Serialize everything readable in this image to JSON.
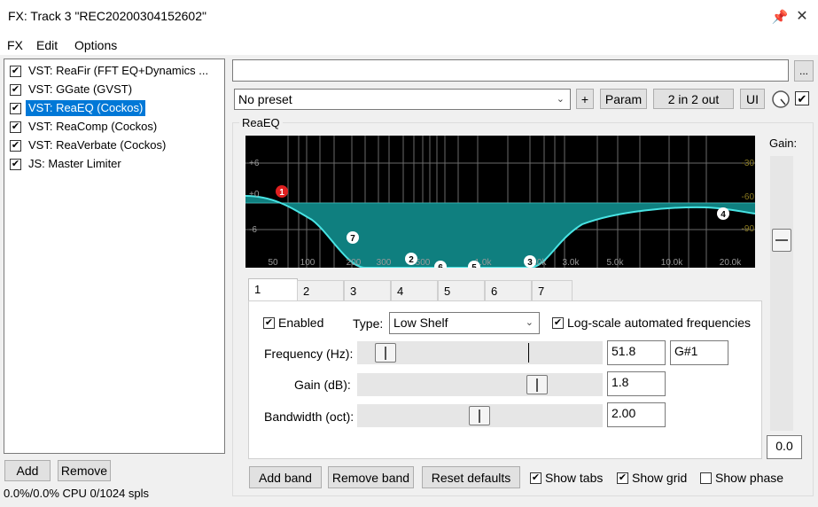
{
  "window": {
    "title": "FX: Track 3 \"REC20200304152602\""
  },
  "menu": [
    "FX",
    "Edit",
    "Options"
  ],
  "fx_chain": [
    {
      "label": "VST: ReaFir (FFT EQ+Dynamics ...",
      "checked": true,
      "selected": false
    },
    {
      "label": "VST: GGate (GVST)",
      "checked": true,
      "selected": false
    },
    {
      "label": "VST: ReaEQ (Cockos)",
      "checked": true,
      "selected": true
    },
    {
      "label": "VST: ReaComp (Cockos)",
      "checked": true,
      "selected": false
    },
    {
      "label": "VST: ReaVerbate (Cockos)",
      "checked": true,
      "selected": false
    },
    {
      "label": "JS: Master Limiter",
      "checked": true,
      "selected": false
    }
  ],
  "chain_buttons": {
    "add": "Add",
    "remove": "Remove"
  },
  "status": "0.0%/0.0% CPU 0/1024 spls",
  "toolbar": {
    "ellipsis": "...",
    "preset": "No preset",
    "plus": "+",
    "param": "Param",
    "io": "2 in 2 out",
    "ui": "UI",
    "enabled_checked": true
  },
  "plugin": {
    "name": "ReaEQ"
  },
  "graph": {
    "db_labels": [
      "+6",
      "+0",
      "-6"
    ],
    "right_labels": [
      "-30",
      "-60",
      "-90"
    ],
    "freq_labels": [
      "50",
      "100",
      "200",
      "300",
      "500",
      "1.0k",
      "2.0k",
      "3.0k",
      "5.0k",
      "10.0k",
      "20.0k"
    ],
    "band_points": [
      "1",
      "7",
      "2",
      "6",
      "5",
      "3",
      "4"
    ],
    "colors": {
      "fill": "#0f7f7f",
      "curve": "#48e4e4",
      "grid": "#6a6a6a",
      "active_point": "#e02020"
    }
  },
  "master_gain": {
    "label": "Gain:",
    "value": "0.0",
    "level_db": 0
  },
  "tabs": [
    "1",
    "2",
    "3",
    "4",
    "5",
    "6",
    "7"
  ],
  "active_tab": "1",
  "band": {
    "enabled_label": "Enabled",
    "enabled": true,
    "type_label": "Type:",
    "type": "Low Shelf",
    "logscale_label": "Log-scale automated frequencies",
    "logscale": true,
    "frequency": {
      "label": "Frequency (Hz):",
      "value": "51.8",
      "note": "G#1"
    },
    "gain": {
      "label": "Gain (dB):",
      "value": "1.8"
    },
    "bandwidth": {
      "label": "Bandwidth (oct):",
      "value": "2.00"
    }
  },
  "bottom": {
    "add_band": "Add band",
    "remove_band": "Remove band",
    "reset": "Reset defaults",
    "show_tabs": "Show tabs",
    "show_tabs_checked": true,
    "show_grid": "Show grid",
    "show_grid_checked": true,
    "show_phase": "Show phase",
    "show_phase_checked": false
  }
}
